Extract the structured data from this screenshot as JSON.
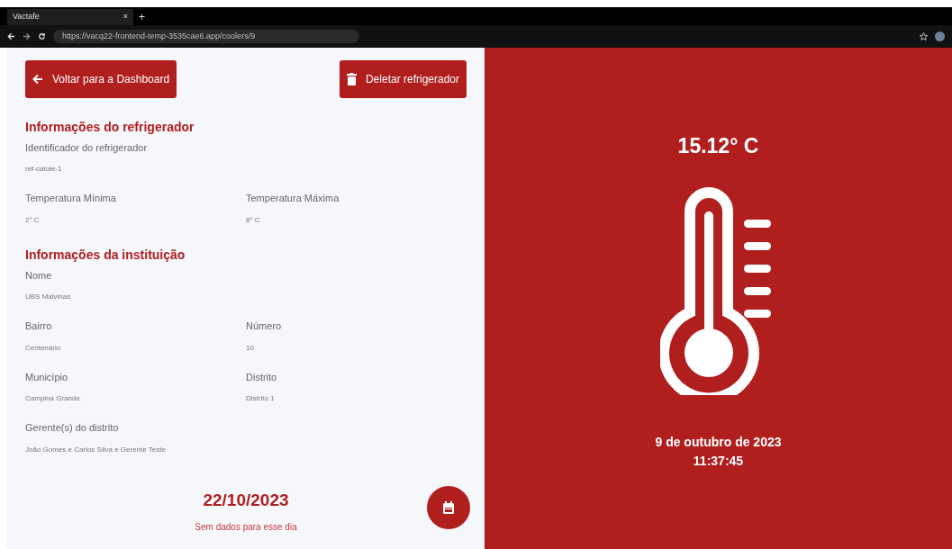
{
  "browser": {
    "tab_title": "Vactafe",
    "tab_close": "×",
    "new_tab": "+",
    "url": "https://vacq22-frontend-temp-3535cae6.app/coolers/9"
  },
  "buttons": [
    {
      "kind": "back",
      "label": "Voltar para a Dashboard"
    },
    {
      "kind": "delete",
      "label": "Deletar refrigerador"
    }
  ],
  "sections": [
    {
      "title": "Informações do refrigerador",
      "rows": [
        [
          {
            "label": "Identificador do refrigerador",
            "value": "ref-catole-1"
          }
        ],
        [
          {
            "label": "Temperatura Mínima",
            "value": "2° C"
          },
          {
            "label": "Temperatura Máxima",
            "value": "8° C"
          }
        ]
      ]
    },
    {
      "title": "Informações da instituição",
      "rows": [
        [
          {
            "label": "Nome",
            "value": "UBS Malvinas"
          }
        ],
        [
          {
            "label": "Bairro",
            "value": "Centenário"
          },
          {
            "label": "Número",
            "value": "10"
          }
        ],
        [
          {
            "label": "Município",
            "value": "Campina Grande"
          },
          {
            "label": "Distrito",
            "value": "Distrito 1"
          }
        ],
        [
          {
            "label": "Gerente(s) do distrito",
            "value": "João Gomes e Carlos Silva e Gerente Teste"
          }
        ]
      ]
    }
  ],
  "selected_date": "22/10/2023",
  "no_data": "Sem dados para esse dia",
  "reading": {
    "temperature": "15.12° C",
    "date": "9 de outubro de 2023",
    "time": "11:37:45"
  }
}
